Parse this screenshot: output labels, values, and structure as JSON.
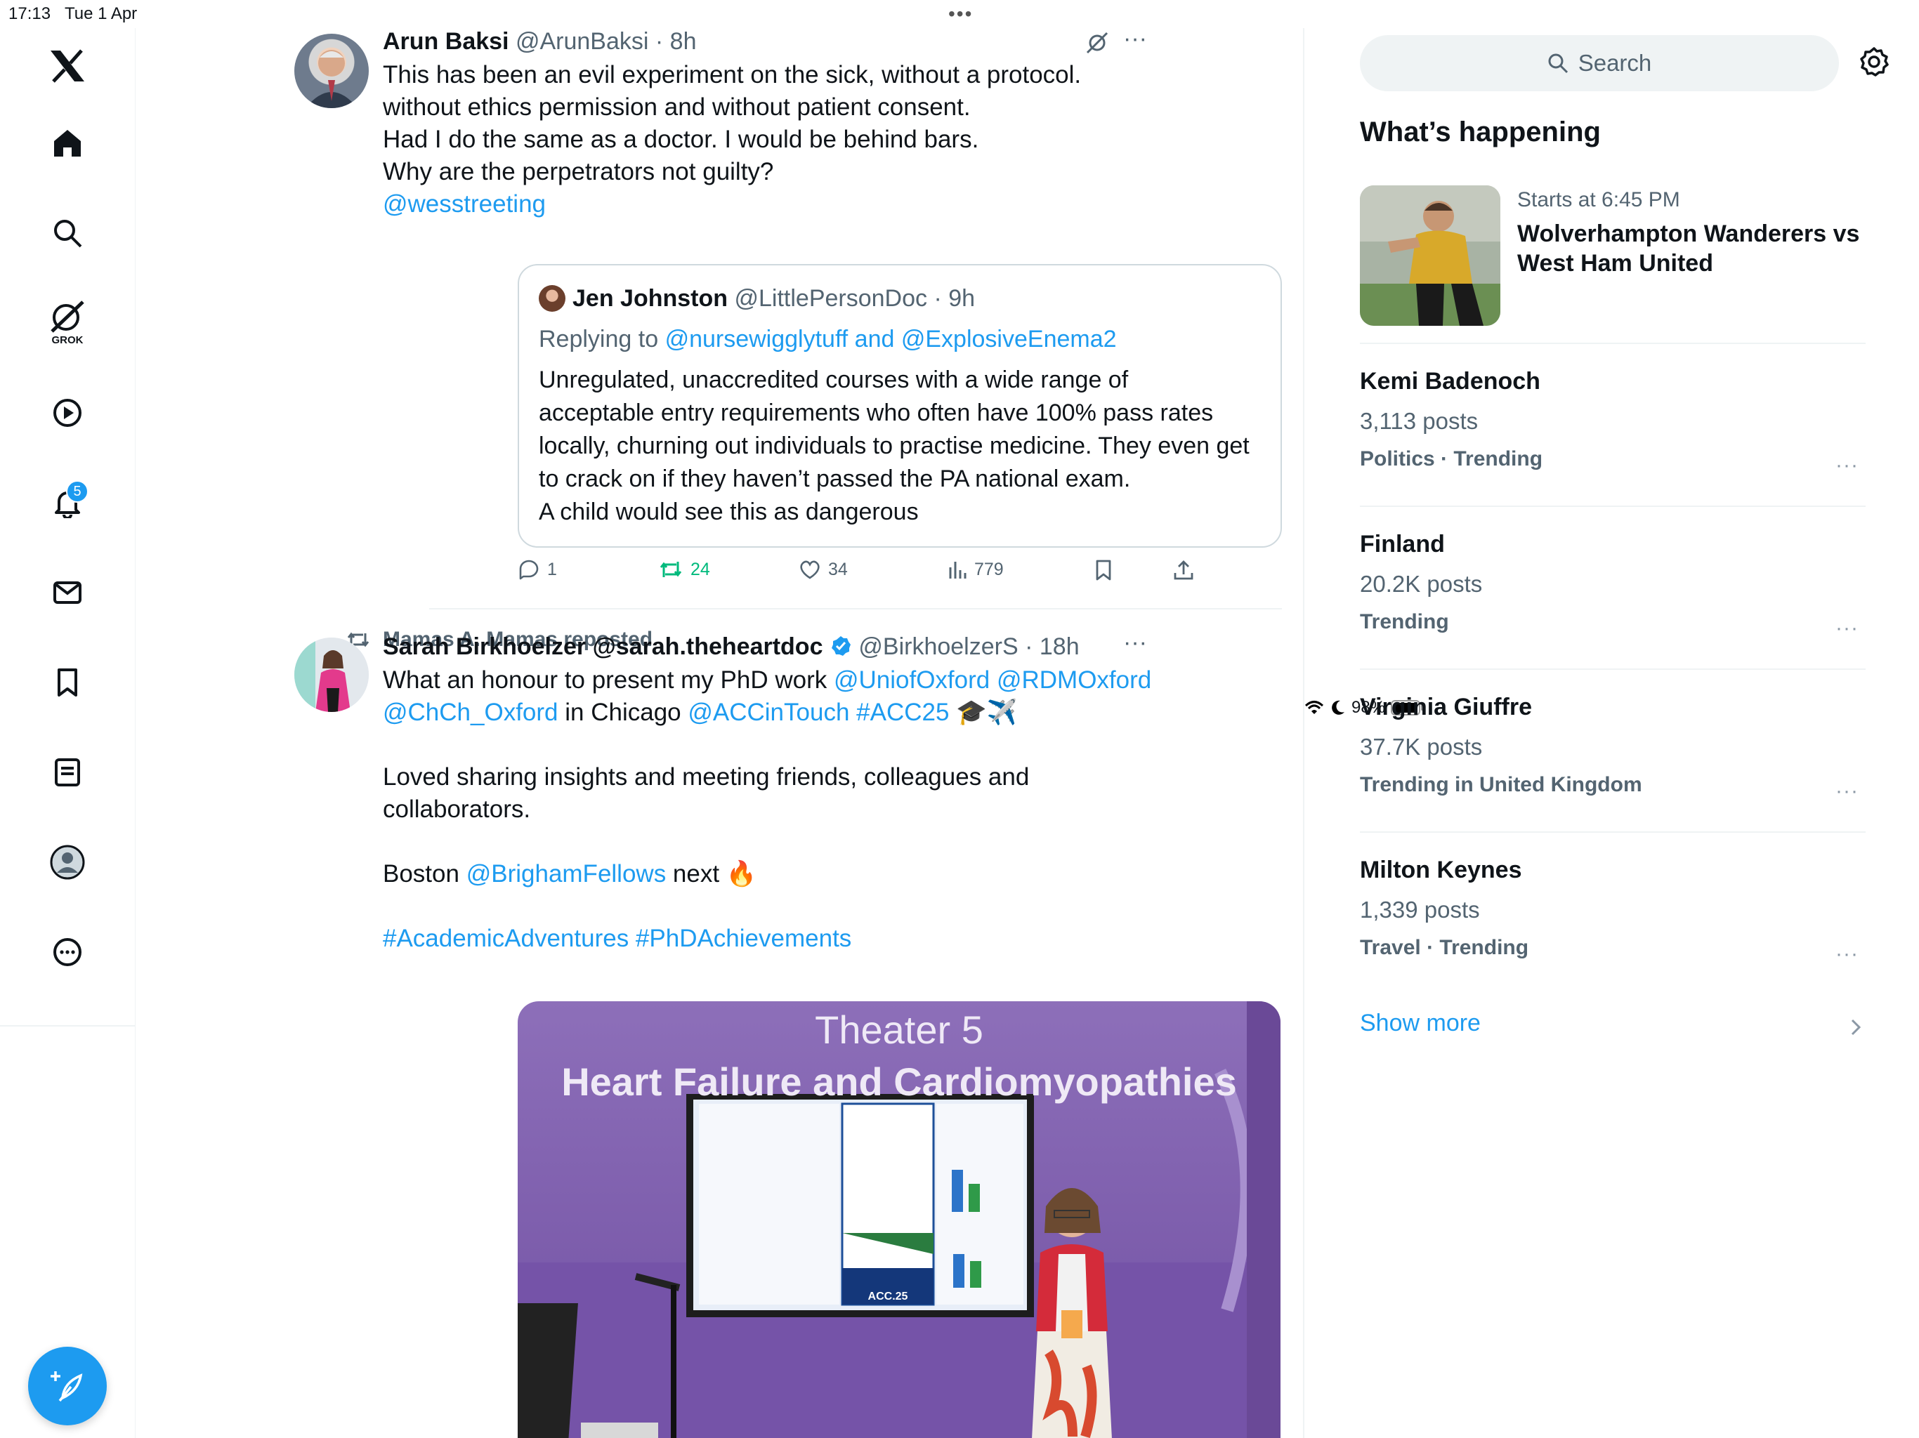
{
  "status_bar": {
    "time": "17:13",
    "date": "Tue 1 Apr",
    "battery": "98%"
  },
  "nav": {
    "grok_label": "GROK",
    "notifications_badge": "5"
  },
  "tweet1": {
    "name": "Arun Baksi",
    "handle": "@ArunBaksi",
    "time": "· 8h",
    "lines": [
      "This has been an evil experiment on the sick, without a protocol.",
      "without ethics permission and without patient consent.",
      "Had I do the same as a doctor. I would be behind bars.",
      "Why are the perpetrators not guilty?"
    ],
    "mention": "@wesstreeting",
    "quote": {
      "name": "Jen Johnston",
      "handle": "@LittlePersonDoc",
      "time": "· 9h",
      "replying_to": "Replying to",
      "replying_handles": "@nursewigglytuff and @ExplosiveEnema2",
      "lines": [
        "Unregulated, unaccredited courses with  a wide range of",
        "acceptable entry requirements who often have 100% pass rates",
        "locally, churning out individuals to practise medicine. They even get",
        "to crack on if they haven’t passed the PA national exam.",
        "A child would see this as dangerous"
      ]
    },
    "actions": {
      "replies": "1",
      "reposts": "24",
      "likes": "34",
      "views": "779"
    }
  },
  "tweet2": {
    "repost_label": "Mamas A. Mamas reposted",
    "name": "Sarah Birkhoelzer @sarah.theheartdoc",
    "handle": "@BirkhoelzerS",
    "time": "· 18h",
    "line1_text": "What an honour to present my PhD work ",
    "line1_links": "@UniofOxford @RDMOxford",
    "line2_link1": "@ChCh_Oxford",
    "line2_text": " in Chicago ",
    "line2_link2": "@ACCinTouch #ACC25",
    "line2_emoji": " 🎓✈️",
    "para2": "Loved sharing insights and meeting friends, colleagues and collaborators.",
    "para3_text": "Boston ",
    "para3_link": "@BrighamFellows",
    "para3_tail": " next 🔥",
    "hashtags": "#AcademicAdventures #PhDAchievements",
    "image": {
      "sign_line1": "Theater 5",
      "sign_line2": "Heart Failure and Cardiomyopathies",
      "poster_label": "ACC.25"
    }
  },
  "sidebar": {
    "search_label": "Search",
    "heading": "What’s happening",
    "event": {
      "time": "Starts at 6:45 PM",
      "title_line1": "Wolverhampton Wanderers vs",
      "title_line2": "West Ham United"
    },
    "trends": [
      {
        "name": "Kemi Badenoch",
        "count": "3,113 posts",
        "context": "Politics · Trending"
      },
      {
        "name": "Finland",
        "count": "20.2K posts",
        "context": "Trending"
      },
      {
        "name": "Virginia Giuffre",
        "count": "37.7K posts",
        "context": "Trending in United Kingdom"
      },
      {
        "name": "Milton Keynes",
        "count": "1,339 posts",
        "context": "Travel · Trending"
      }
    ],
    "show_more": "Show more"
  }
}
